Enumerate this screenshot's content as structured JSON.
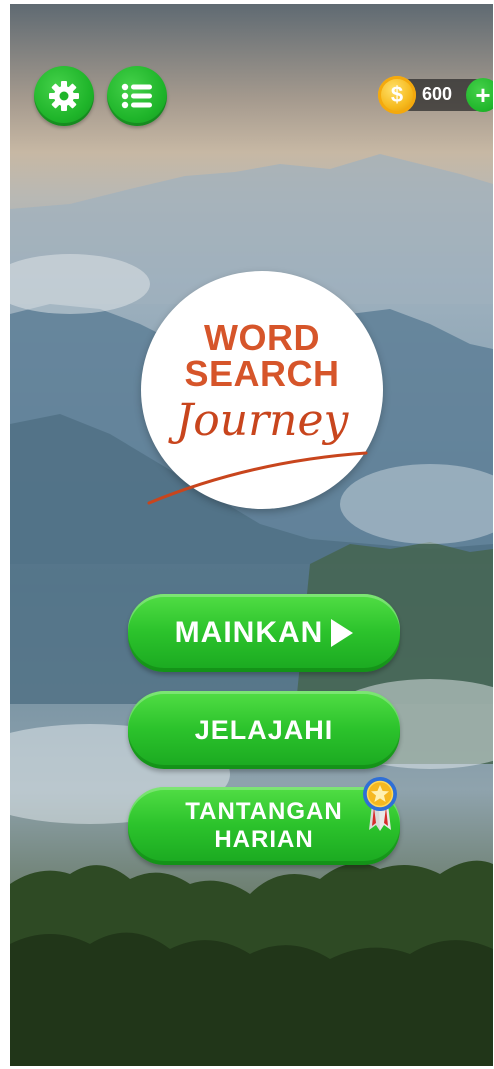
{
  "top_bar": {
    "settings_icon": "gear-icon",
    "list_icon": "list-icon",
    "coins": "600",
    "coin_symbol": "$",
    "add_coins_icon": "+"
  },
  "logo": {
    "line1": "WORD",
    "line2": "SEARCH",
    "line3": "Journey"
  },
  "menu": {
    "play_label": "MAINKAN",
    "explore_label": "JELAJAHI",
    "daily_line1": "TANTANGAN",
    "daily_line2": "HARIAN",
    "daily_badge_icon": "medal-icon"
  },
  "colors": {
    "button_green": "#2cc32c",
    "logo_orange": "#d6552a",
    "coin_gold": "#f6b91c"
  }
}
